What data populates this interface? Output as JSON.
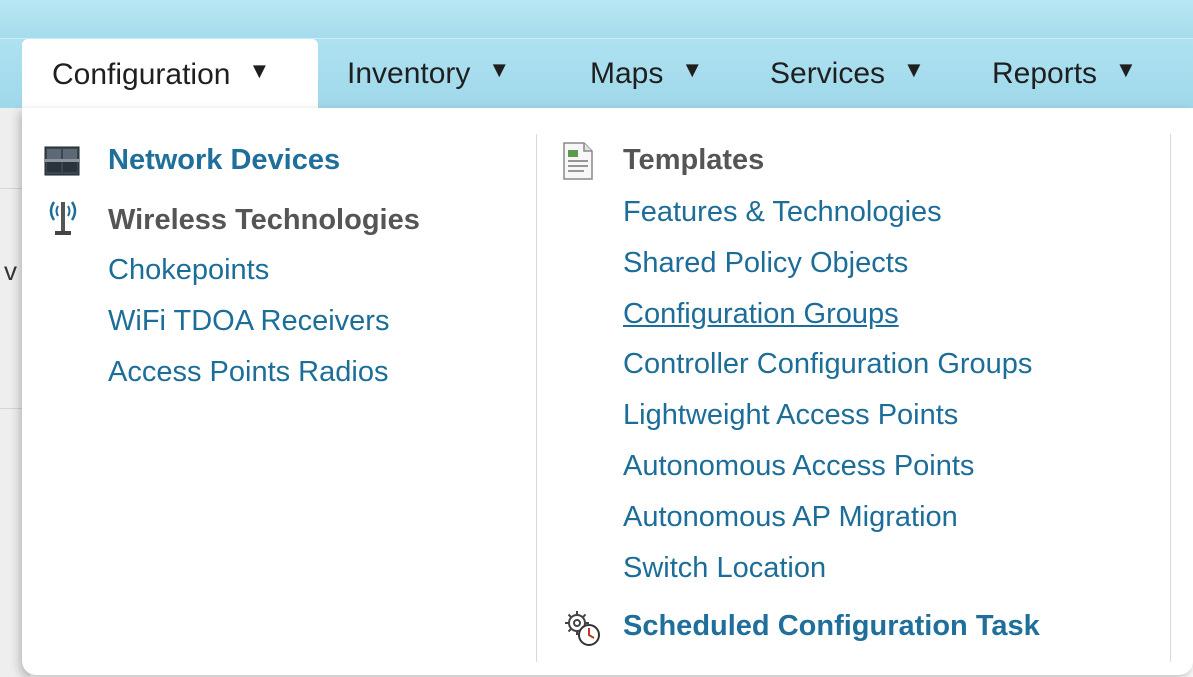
{
  "nav": {
    "tabs": [
      {
        "label": "Configuration",
        "arrow": "▼"
      },
      {
        "label": "Inventory",
        "arrow": "▼"
      },
      {
        "label": "Maps",
        "arrow": "▼"
      },
      {
        "label": "Services",
        "arrow": "▼"
      },
      {
        "label": "Reports",
        "arrow": "▼"
      }
    ]
  },
  "menu": {
    "left": {
      "network_devices": "Network Devices",
      "wireless_technologies": "Wireless Technologies",
      "items": [
        "Chokepoints",
        "WiFi TDOA Receivers",
        "Access Points Radios"
      ]
    },
    "right": {
      "templates": "Templates",
      "items": [
        "Features & Technologies",
        "Shared Policy Objects",
        "Configuration Groups",
        "Controller Configuration Groups",
        "Lightweight Access Points",
        "Autonomous Access Points",
        "Autonomous AP Migration",
        "Switch Location"
      ],
      "scheduled_task": "Scheduled Configuration Task"
    }
  },
  "backdrop_fragment": "v",
  "colors": {
    "accent": "#1d6d99",
    "nav_bg": "#a6dced"
  },
  "icons": {
    "network_devices": "network-devices-icon",
    "wireless": "wireless-antenna-icon",
    "templates": "template-document-icon",
    "scheduled": "scheduled-gear-clock-icon"
  }
}
